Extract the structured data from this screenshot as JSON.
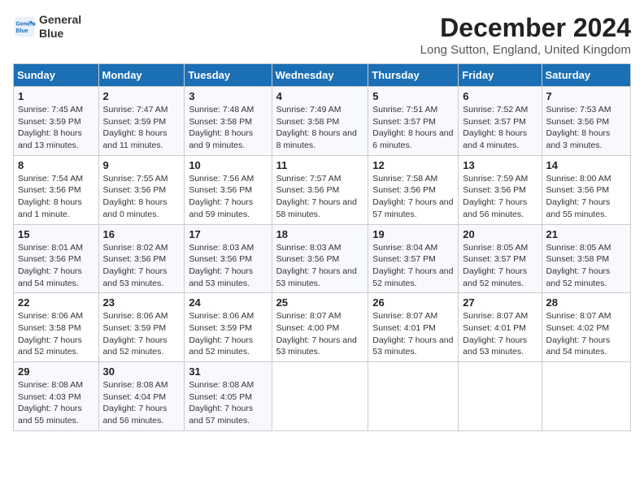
{
  "header": {
    "logo_line1": "General",
    "logo_line2": "Blue",
    "month": "December 2024",
    "location": "Long Sutton, England, United Kingdom"
  },
  "weekdays": [
    "Sunday",
    "Monday",
    "Tuesday",
    "Wednesday",
    "Thursday",
    "Friday",
    "Saturday"
  ],
  "weeks": [
    [
      {
        "day": "1",
        "sunrise": "7:45 AM",
        "sunset": "3:59 PM",
        "daylight": "8 hours and 13 minutes."
      },
      {
        "day": "2",
        "sunrise": "7:47 AM",
        "sunset": "3:59 PM",
        "daylight": "8 hours and 11 minutes."
      },
      {
        "day": "3",
        "sunrise": "7:48 AM",
        "sunset": "3:58 PM",
        "daylight": "8 hours and 9 minutes."
      },
      {
        "day": "4",
        "sunrise": "7:49 AM",
        "sunset": "3:58 PM",
        "daylight": "8 hours and 8 minutes."
      },
      {
        "day": "5",
        "sunrise": "7:51 AM",
        "sunset": "3:57 PM",
        "daylight": "8 hours and 6 minutes."
      },
      {
        "day": "6",
        "sunrise": "7:52 AM",
        "sunset": "3:57 PM",
        "daylight": "8 hours and 4 minutes."
      },
      {
        "day": "7",
        "sunrise": "7:53 AM",
        "sunset": "3:56 PM",
        "daylight": "8 hours and 3 minutes."
      }
    ],
    [
      {
        "day": "8",
        "sunrise": "7:54 AM",
        "sunset": "3:56 PM",
        "daylight": "8 hours and 1 minute."
      },
      {
        "day": "9",
        "sunrise": "7:55 AM",
        "sunset": "3:56 PM",
        "daylight": "8 hours and 0 minutes."
      },
      {
        "day": "10",
        "sunrise": "7:56 AM",
        "sunset": "3:56 PM",
        "daylight": "7 hours and 59 minutes."
      },
      {
        "day": "11",
        "sunrise": "7:57 AM",
        "sunset": "3:56 PM",
        "daylight": "7 hours and 58 minutes."
      },
      {
        "day": "12",
        "sunrise": "7:58 AM",
        "sunset": "3:56 PM",
        "daylight": "7 hours and 57 minutes."
      },
      {
        "day": "13",
        "sunrise": "7:59 AM",
        "sunset": "3:56 PM",
        "daylight": "7 hours and 56 minutes."
      },
      {
        "day": "14",
        "sunrise": "8:00 AM",
        "sunset": "3:56 PM",
        "daylight": "7 hours and 55 minutes."
      }
    ],
    [
      {
        "day": "15",
        "sunrise": "8:01 AM",
        "sunset": "3:56 PM",
        "daylight": "7 hours and 54 minutes."
      },
      {
        "day": "16",
        "sunrise": "8:02 AM",
        "sunset": "3:56 PM",
        "daylight": "7 hours and 53 minutes."
      },
      {
        "day": "17",
        "sunrise": "8:03 AM",
        "sunset": "3:56 PM",
        "daylight": "7 hours and 53 minutes."
      },
      {
        "day": "18",
        "sunrise": "8:03 AM",
        "sunset": "3:56 PM",
        "daylight": "7 hours and 53 minutes."
      },
      {
        "day": "19",
        "sunrise": "8:04 AM",
        "sunset": "3:57 PM",
        "daylight": "7 hours and 52 minutes."
      },
      {
        "day": "20",
        "sunrise": "8:05 AM",
        "sunset": "3:57 PM",
        "daylight": "7 hours and 52 minutes."
      },
      {
        "day": "21",
        "sunrise": "8:05 AM",
        "sunset": "3:58 PM",
        "daylight": "7 hours and 52 minutes."
      }
    ],
    [
      {
        "day": "22",
        "sunrise": "8:06 AM",
        "sunset": "3:58 PM",
        "daylight": "7 hours and 52 minutes."
      },
      {
        "day": "23",
        "sunrise": "8:06 AM",
        "sunset": "3:59 PM",
        "daylight": "7 hours and 52 minutes."
      },
      {
        "day": "24",
        "sunrise": "8:06 AM",
        "sunset": "3:59 PM",
        "daylight": "7 hours and 52 minutes."
      },
      {
        "day": "25",
        "sunrise": "8:07 AM",
        "sunset": "4:00 PM",
        "daylight": "7 hours and 53 minutes."
      },
      {
        "day": "26",
        "sunrise": "8:07 AM",
        "sunset": "4:01 PM",
        "daylight": "7 hours and 53 minutes."
      },
      {
        "day": "27",
        "sunrise": "8:07 AM",
        "sunset": "4:01 PM",
        "daylight": "7 hours and 53 minutes."
      },
      {
        "day": "28",
        "sunrise": "8:07 AM",
        "sunset": "4:02 PM",
        "daylight": "7 hours and 54 minutes."
      }
    ],
    [
      {
        "day": "29",
        "sunrise": "8:08 AM",
        "sunset": "4:03 PM",
        "daylight": "7 hours and 55 minutes."
      },
      {
        "day": "30",
        "sunrise": "8:08 AM",
        "sunset": "4:04 PM",
        "daylight": "7 hours and 56 minutes."
      },
      {
        "day": "31",
        "sunrise": "8:08 AM",
        "sunset": "4:05 PM",
        "daylight": "7 hours and 57 minutes."
      },
      null,
      null,
      null,
      null
    ]
  ]
}
